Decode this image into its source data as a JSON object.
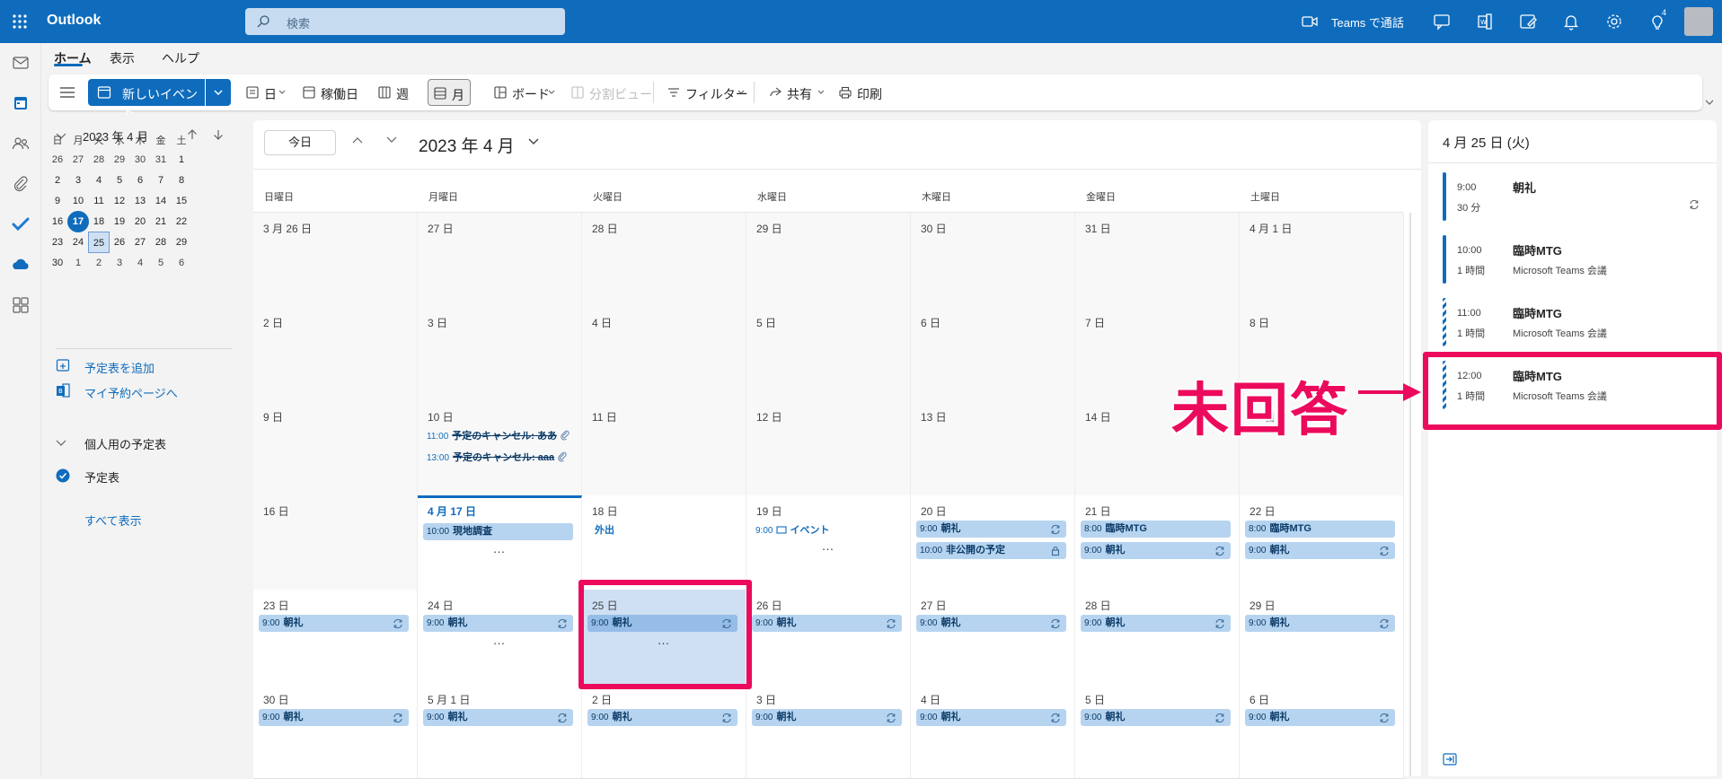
{
  "app": {
    "name": "Outlook"
  },
  "search": {
    "placeholder": "検索"
  },
  "topbar": {
    "teams_call": "Teams で通話",
    "tips_badge": "4"
  },
  "ribbon": {
    "tabs": [
      "ホーム",
      "表示",
      "ヘルプ"
    ]
  },
  "toolbar": {
    "new_event": "新しいイベント",
    "day": "日",
    "work_week": "稼働日",
    "week": "週",
    "month": "月",
    "board": "ボード",
    "split_view": "分割ビュー",
    "filter": "フィルター",
    "share": "共有",
    "print": "印刷"
  },
  "mini_cal": {
    "title": "2023 年 4 月",
    "weekdays": [
      "日",
      "月",
      "火",
      "水",
      "木",
      "金",
      "土"
    ],
    "weeks": [
      [
        "26",
        "27",
        "28",
        "29",
        "30",
        "31",
        "1"
      ],
      [
        "2",
        "3",
        "4",
        "5",
        "6",
        "7",
        "8"
      ],
      [
        "9",
        "10",
        "11",
        "12",
        "13",
        "14",
        "15"
      ],
      [
        "16",
        "17",
        "18",
        "19",
        "20",
        "21",
        "22"
      ],
      [
        "23",
        "24",
        "25",
        "26",
        "27",
        "28",
        "29"
      ],
      [
        "30",
        "1",
        "2",
        "3",
        "4",
        "5",
        "6"
      ]
    ],
    "today": "17",
    "selected": "25"
  },
  "left_pane": {
    "add_calendar": "予定表を追加",
    "booking_page": "マイ予約ページへ",
    "my_calendars": "個人用の予定表",
    "calendar": "予定表",
    "show_all": "すべて表示"
  },
  "calendar": {
    "today_button": "今日",
    "title": "2023 年 4 月",
    "weekdays": [
      "日曜日",
      "月曜日",
      "火曜日",
      "水曜日",
      "木曜日",
      "金曜日",
      "土曜日"
    ],
    "weeks": [
      [
        {
          "date": "3 月 26 日",
          "past": true,
          "events": []
        },
        {
          "date": "27 日",
          "past": true,
          "events": []
        },
        {
          "date": "28 日",
          "past": true,
          "events": []
        },
        {
          "date": "29 日",
          "past": true,
          "events": []
        },
        {
          "date": "30 日",
          "past": true,
          "events": []
        },
        {
          "date": "31 日",
          "past": true,
          "events": []
        },
        {
          "date": "4 月 1 日",
          "past": true,
          "events": []
        }
      ],
      [
        {
          "date": "2 日",
          "past": true,
          "events": []
        },
        {
          "date": "3 日",
          "past": true,
          "events": []
        },
        {
          "date": "4 日",
          "past": true,
          "events": []
        },
        {
          "date": "5 日",
          "past": true,
          "events": []
        },
        {
          "date": "6 日",
          "past": true,
          "events": []
        },
        {
          "date": "7 日",
          "past": true,
          "events": []
        },
        {
          "date": "8 日",
          "past": true,
          "events": []
        }
      ],
      [
        {
          "date": "9 日",
          "past": true,
          "events": []
        },
        {
          "date": "10 日",
          "past": true,
          "events": [
            {
              "time": "11:00",
              "title": "予定のキャンセル: ああ",
              "style": "strike",
              "icon": "paperclip-icon"
            },
            {
              "time": "13:00",
              "title": "予定のキャンセル: aaa",
              "style": "strike",
              "icon": "paperclip-icon"
            }
          ]
        },
        {
          "date": "11 日",
          "past": true,
          "events": []
        },
        {
          "date": "12 日",
          "past": true,
          "events": []
        },
        {
          "date": "13 日",
          "past": true,
          "events": []
        },
        {
          "date": "14 日",
          "past": true,
          "events": []
        },
        {
          "date": "15 日",
          "past": true,
          "events": []
        }
      ],
      [
        {
          "date": "16 日",
          "past": true,
          "events": []
        },
        {
          "date": "4 月 17 日",
          "today": true,
          "events": [
            {
              "time": "10:00",
              "title": "現地調査",
              "style": "block"
            }
          ],
          "more": "…"
        },
        {
          "date": "18 日",
          "events": [
            {
              "time": "",
              "title": "外出",
              "style": "text"
            }
          ]
        },
        {
          "date": "19 日",
          "events": [
            {
              "time": "9:00",
              "title": "イベント",
              "style": "text",
              "icon": "box-icon"
            }
          ],
          "more": "…"
        },
        {
          "date": "20 日",
          "events": [
            {
              "time": "9:00",
              "title": "朝礼",
              "style": "block",
              "icon": "recurring-icon"
            },
            {
              "time": "10:00",
              "title": "非公開の予定",
              "style": "block",
              "icon": "lock-icon"
            }
          ]
        },
        {
          "date": "21 日",
          "events": [
            {
              "time": "8:00",
              "title": "臨時MTG",
              "style": "block"
            },
            {
              "time": "9:00",
              "title": "朝礼",
              "style": "block",
              "icon": "recurring-icon"
            }
          ]
        },
        {
          "date": "22 日",
          "events": [
            {
              "time": "8:00",
              "title": "臨時MTG",
              "style": "block"
            },
            {
              "time": "9:00",
              "title": "朝礼",
              "style": "block",
              "icon": "recurring-icon"
            }
          ]
        }
      ],
      [
        {
          "date": "23 日",
          "events": [
            {
              "time": "9:00",
              "title": "朝礼",
              "style": "block",
              "icon": "recurring-icon"
            }
          ]
        },
        {
          "date": "24 日",
          "events": [
            {
              "time": "9:00",
              "title": "朝礼",
              "style": "block",
              "icon": "recurring-icon"
            }
          ],
          "more": "…"
        },
        {
          "date": "25 日",
          "selected": true,
          "events": [
            {
              "time": "9:00",
              "title": "朝礼",
              "style": "block",
              "icon": "recurring-icon"
            }
          ],
          "more": "…"
        },
        {
          "date": "26 日",
          "events": [
            {
              "time": "9:00",
              "title": "朝礼",
              "style": "block",
              "icon": "recurring-icon"
            }
          ]
        },
        {
          "date": "27 日",
          "events": [
            {
              "time": "9:00",
              "title": "朝礼",
              "style": "block",
              "icon": "recurring-icon"
            }
          ]
        },
        {
          "date": "28 日",
          "events": [
            {
              "time": "9:00",
              "title": "朝礼",
              "style": "block",
              "icon": "recurring-icon"
            }
          ]
        },
        {
          "date": "29 日",
          "events": [
            {
              "time": "9:00",
              "title": "朝礼",
              "style": "block",
              "icon": "recurring-icon"
            }
          ]
        }
      ],
      [
        {
          "date": "30 日",
          "events": [
            {
              "time": "9:00",
              "title": "朝礼",
              "style": "block",
              "icon": "recurring-icon"
            }
          ]
        },
        {
          "date": "5 月 1 日",
          "events": [
            {
              "time": "9:00",
              "title": "朝礼",
              "style": "block",
              "icon": "recurring-icon"
            }
          ]
        },
        {
          "date": "2 日",
          "events": [
            {
              "time": "9:00",
              "title": "朝礼",
              "style": "block",
              "icon": "recurring-icon"
            }
          ]
        },
        {
          "date": "3 日",
          "events": [
            {
              "time": "9:00",
              "title": "朝礼",
              "style": "block",
              "icon": "recurring-icon"
            }
          ]
        },
        {
          "date": "4 日",
          "events": [
            {
              "time": "9:00",
              "title": "朝礼",
              "style": "block",
              "icon": "recurring-icon"
            }
          ]
        },
        {
          "date": "5 日",
          "events": [
            {
              "time": "9:00",
              "title": "朝礼",
              "style": "block",
              "icon": "recurring-icon"
            }
          ]
        },
        {
          "date": "6 日",
          "events": [
            {
              "time": "9:00",
              "title": "朝礼",
              "style": "block",
              "icon": "recurring-icon"
            }
          ]
        }
      ]
    ]
  },
  "agenda": {
    "title": "4 月 25 日 (火)",
    "items": [
      {
        "time": "9:00",
        "duration": "30 分",
        "subject": "朝礼",
        "location": "",
        "recurring": true,
        "tentative": false
      },
      {
        "time": "10:00",
        "duration": "1 時間",
        "subject": "臨時MTG",
        "location": "Microsoft Teams 会議",
        "recurring": false,
        "tentative": false
      },
      {
        "time": "11:00",
        "duration": "1 時間",
        "subject": "臨時MTG",
        "location": "Microsoft Teams 会議",
        "recurring": false,
        "tentative": true
      },
      {
        "time": "12:00",
        "duration": "1 時間",
        "subject": "臨時MTG",
        "location": "Microsoft Teams 会議",
        "recurring": false,
        "tentative": true
      }
    ]
  },
  "annotation": {
    "label": "未回答",
    "color": "#ec0a5c"
  },
  "colors": {
    "brand": "#0f6cbd",
    "event": "#b6d4f0",
    "selected_day": "#cfe0f4"
  }
}
